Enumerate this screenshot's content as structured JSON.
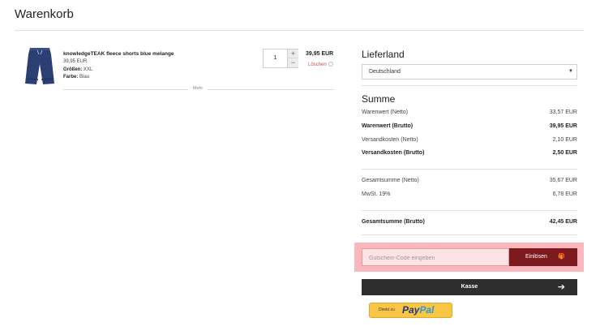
{
  "page": {
    "title": "Warenkorb"
  },
  "cart": {
    "item": {
      "name": "knowledgeTEAK fleece shorts blue melange",
      "unit_price": "39,95 EUR",
      "size_label": "Größen:",
      "size_value": "XXL",
      "color_label": "Farbe:",
      "color_value": "Blau",
      "quantity": "1",
      "line_total": "39,95 EUR",
      "delete_label": "Löschen"
    },
    "more_label": "Mehr"
  },
  "delivery": {
    "heading": "Lieferland",
    "country": "Deutschland"
  },
  "summary": {
    "heading": "Summe",
    "rows": [
      {
        "label": "Warenwert (Netto)",
        "value": "33,57 EUR"
      },
      {
        "label": "Warenwert (Brutto)",
        "value": "39,95 EUR"
      },
      {
        "label": "Versandkosten (Netto)",
        "value": "2,10 EUR"
      },
      {
        "label": "Versandkosten (Brutto)",
        "value": "2,50 EUR"
      },
      {
        "label": "Gesamtsumme (Netto)",
        "value": "35,67 EUR"
      },
      {
        "label": "MwSt. 19%",
        "value": "6,78 EUR"
      },
      {
        "label": "Gesamtsumme (Brutto)",
        "value": "42,45 EUR"
      }
    ]
  },
  "coupon": {
    "placeholder": "Gutschein-Code eingeben",
    "button_label": "Einlösen"
  },
  "checkout": {
    "label": "Kasse"
  },
  "paypal": {
    "prefix": "Direkt zu",
    "logo_part1": "Pay",
    "logo_part2": "Pal"
  },
  "icons": {
    "gift": "gift-icon",
    "arrow": "arrow-right-icon",
    "delete": "circle-x-icon",
    "caret": "caret-down-icon"
  },
  "colors": {
    "accent": "#7d1a1e",
    "highlight": "#fbb7bd",
    "delete_text": "#d14b4b",
    "checkout_bg": "#2e2e2e",
    "paypal_bg": "#f8c544",
    "product_color": "#2c3f72"
  }
}
